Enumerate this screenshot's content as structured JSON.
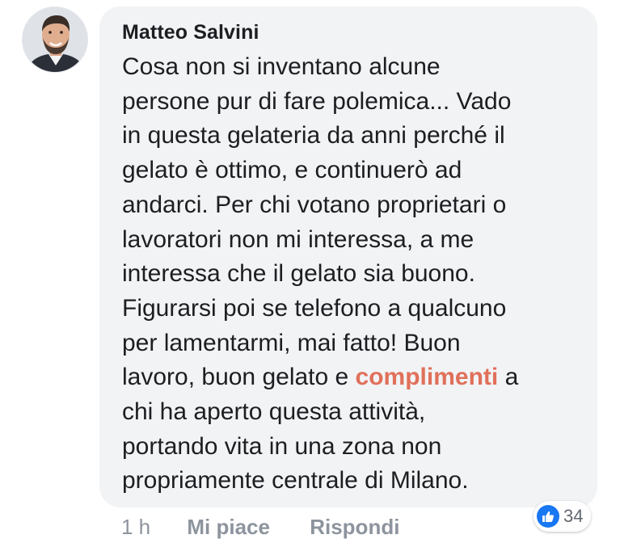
{
  "comment": {
    "author": "Matteo Salvini",
    "lines": [
      "Cosa non si inventano alcune",
      "persone pur di fare polemica... Vado",
      "in questa gelateria da anni perché il",
      "gelato è ottimo, e continuerò ad",
      "andarci. Per chi votano proprietari o",
      "lavoratori non mi interessa, a me",
      "interessa che il gelato sia buono.",
      "Figurarsi poi se telefono a qualcuno",
      "per lamentarmi, mai fatto! Buon"
    ],
    "line10_before": "lavoro, buon gelato e ",
    "tag": "complimenti",
    "line10_after": " a",
    "lines_end": [
      "chi ha aperto questa attività,",
      "portando vita in una zona non",
      "propriamente centrale di Milano."
    ],
    "tag_color": "#e0705a"
  },
  "footer": {
    "time": "1 h",
    "like_label": "Mi piace",
    "reply_label": "Rispondi"
  },
  "reactions": {
    "icon": "thumbs-up-icon",
    "count": "34",
    "color": "#1877f2"
  }
}
